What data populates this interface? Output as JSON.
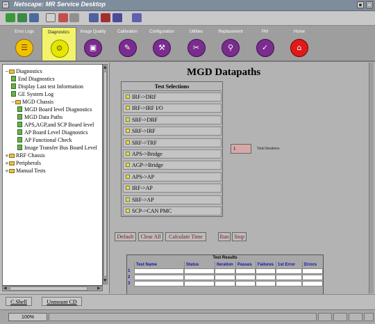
{
  "window": {
    "title": "Netscape: MR Service Desktop"
  },
  "tabs": [
    {
      "label": "Error Logs",
      "icon": "list-icon",
      "glyph": "☰",
      "color": "yellow"
    },
    {
      "label": "Diagnostics",
      "icon": "gear-icon",
      "glyph": "⚙",
      "active": true
    },
    {
      "label": "Image Quality",
      "icon": "image-quality-icon",
      "glyph": "▣"
    },
    {
      "label": "Calibration",
      "icon": "calibration-icon",
      "glyph": "✎"
    },
    {
      "label": "Configuration",
      "icon": "configuration-icon",
      "glyph": "⚒"
    },
    {
      "label": "Utilities",
      "icon": "utilities-icon",
      "glyph": "✂"
    },
    {
      "label": "Replacement",
      "icon": "replacement-icon",
      "glyph": "⚲"
    },
    {
      "label": "PM",
      "icon": "pm-icon",
      "glyph": "✓"
    },
    {
      "label": "Home",
      "icon": "home-icon",
      "glyph": "⌂",
      "color": "red"
    }
  ],
  "tree": [
    {
      "label": "Diagnostics",
      "type": "folder",
      "level": 0,
      "exp": "−"
    },
    {
      "label": "End Diagnostics",
      "type": "doc",
      "level": 1
    },
    {
      "label": "Display Last test Information",
      "type": "doc",
      "level": 1
    },
    {
      "label": "GE System Log",
      "type": "doc",
      "level": 1
    },
    {
      "label": "MGD Chassis",
      "type": "folder",
      "level": 1,
      "exp": "−"
    },
    {
      "label": "MGD Board level Diagnostics",
      "type": "doc",
      "level": 2
    },
    {
      "label": "MGD Data Paths",
      "type": "doc",
      "level": 2
    },
    {
      "label": "APS,AGP,and SCP Board level",
      "type": "doc",
      "level": 2
    },
    {
      "label": "AP Board Level Diagnostics",
      "type": "doc",
      "level": 2
    },
    {
      "label": "AP Functional Check",
      "type": "doc",
      "level": 2
    },
    {
      "label": "Image Transfer Bus Board Level",
      "type": "doc",
      "level": 2
    },
    {
      "label": "RRF Chassis",
      "type": "folder",
      "level": 0,
      "exp": "+"
    },
    {
      "label": "Peripherals",
      "type": "folder",
      "level": 0,
      "exp": "+"
    },
    {
      "label": "Manual Tests",
      "type": "folder",
      "level": 0,
      "exp": "+"
    }
  ],
  "main": {
    "heading": "MGD Datapaths",
    "selections_title": "Test Selections",
    "selections": [
      "IRF->DRF",
      "IRF->IRF I/O",
      "SRF->DRF",
      "SRF->IRF",
      "SRF->TRF",
      "APS->Bridge",
      "AGP->Bridge",
      "APS->AP",
      "IRF->AP",
      "SRF->AP",
      "SCP->CAN PMC"
    ],
    "iterations_value": "1",
    "iterations_label": "Total Iterations",
    "buttons": [
      "Default",
      "Clear All",
      "Calculate Time",
      "Run",
      "Stop"
    ],
    "results_title": "Test Results",
    "results_columns": [
      "Test Name",
      "Status",
      "Iteration",
      "Passes",
      "Failures",
      "1st Error",
      "Errors"
    ],
    "results_rows": [
      "1",
      "2",
      "3"
    ]
  },
  "bottom": {
    "buttons": [
      "C.Shell",
      "Unmount CD"
    ]
  },
  "status": {
    "zoom": "100%"
  }
}
